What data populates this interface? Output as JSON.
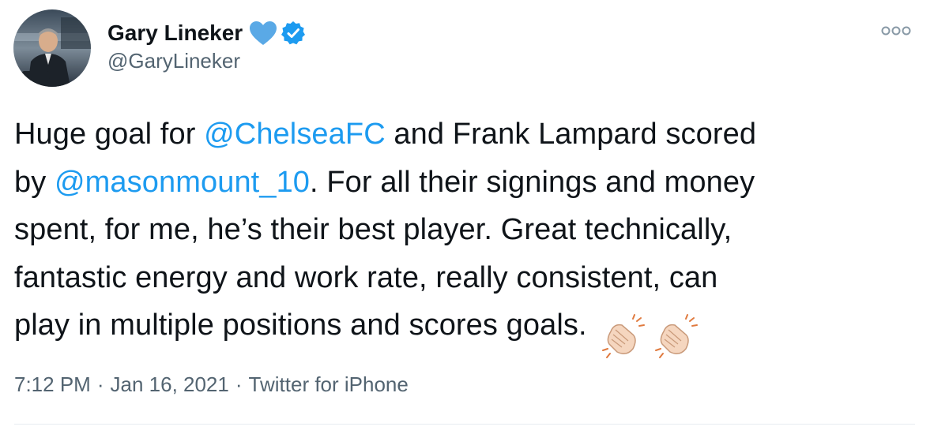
{
  "author": {
    "display_name": "Gary Lineker",
    "handle": "@GaryLineker",
    "heart_color": "#5aa9e6",
    "verified_color": "#1d9bf0"
  },
  "tweet": {
    "lines": [
      [
        {
          "text": "Huge goal for ",
          "type": "text"
        },
        {
          "text": "@ChelseaFC",
          "type": "mention"
        },
        {
          "text": " and Frank Lampard scored",
          "type": "text"
        }
      ],
      [
        {
          "text": "by ",
          "type": "text"
        },
        {
          "text": "@masonmount_10",
          "type": "mention"
        },
        {
          "text": ". For all their signings and money",
          "type": "text"
        }
      ],
      [
        {
          "text": "spent, for me, he’s their best player. Great technically,",
          "type": "text"
        }
      ],
      [
        {
          "text": "fantastic energy and work rate, really consistent, can",
          "type": "text"
        }
      ],
      [
        {
          "text": "play in multiple positions and scores goals. ",
          "type": "text"
        }
      ]
    ],
    "emojis": [
      "clapping-hands-light-skin",
      "clapping-hands-light-skin"
    ],
    "mention_color": "#1d9bf0"
  },
  "meta": {
    "time": "7:12 PM",
    "separator": "·",
    "date": "Jan 16, 2021",
    "source": "Twitter for iPhone"
  },
  "more_icon": "more-dots-icon"
}
